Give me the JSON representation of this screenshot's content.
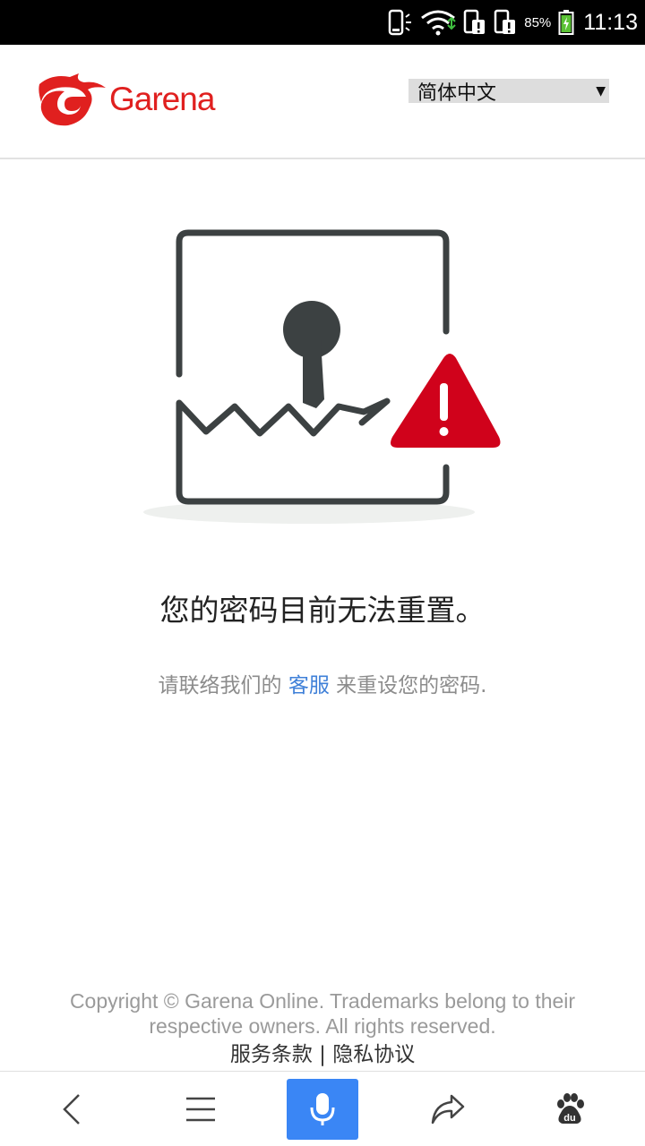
{
  "status_bar": {
    "battery_percent": "85%",
    "time": "11:13",
    "icons": [
      "phone-vibrate-icon",
      "wifi-icon",
      "sim-alert-icon",
      "sim-alert-icon",
      "battery-charging-icon"
    ]
  },
  "header": {
    "logo_text": "Garena",
    "language_select": {
      "selected": "简体中文"
    }
  },
  "illustration": {
    "icon": "broken-lock-document-icon",
    "alert_icon": "warning-triangle-icon"
  },
  "message": {
    "title": "您的密码目前无法重置。",
    "subtitle_before": "请联络我们的",
    "subtitle_link": "客服",
    "subtitle_after": "来重设您的密码."
  },
  "footer": {
    "copyright": "Copyright © Garena Online. Trademarks belong to their respective owners. All rights reserved.",
    "terms_link": "服务条款",
    "separator": "|",
    "privacy_link": "隐私协议"
  },
  "bottom_nav": {
    "items": [
      "back-icon",
      "menu-icon",
      "microphone-icon",
      "share-icon",
      "baidu-paw-icon"
    ]
  },
  "colors": {
    "brand_red": "#e0201f",
    "link_blue": "#3f80d8",
    "mic_blue": "#3a86f5",
    "alert_red": "#d0021b"
  }
}
